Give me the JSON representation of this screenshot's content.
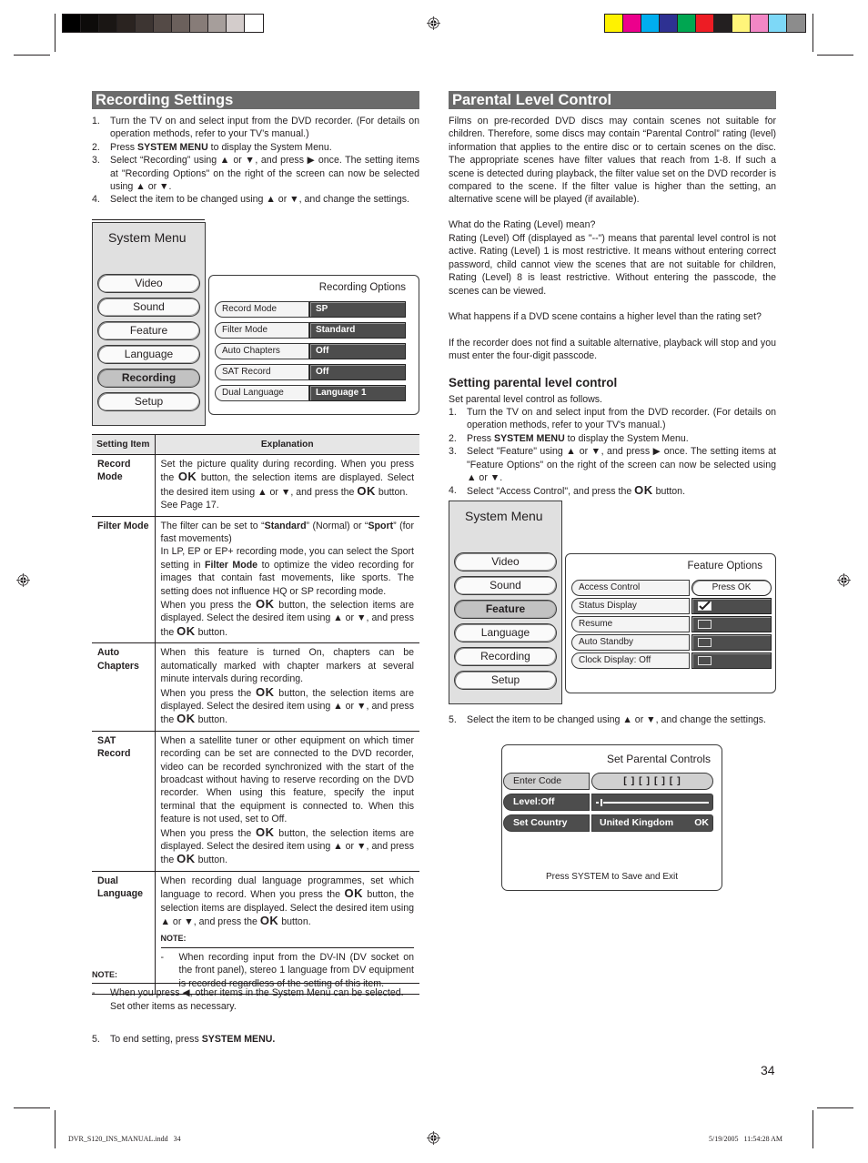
{
  "print_marks": {
    "grayscale_swatches": [
      "#000000",
      "#0d0b0a",
      "#1a1614",
      "#2a2320",
      "#3d3532",
      "#544a46",
      "#6b605c",
      "#877c78",
      "#a69e9b",
      "#d3cccb",
      "#ffffff"
    ],
    "color_swatches": [
      "#fff200",
      "#ec008c",
      "#00aeef",
      "#2e3192",
      "#00a651",
      "#ed1c24",
      "#231f20",
      "#fff57a",
      "#f287c5",
      "#7dd8f7",
      "#8c8c8c"
    ]
  },
  "recording": {
    "title": "Recording Settings",
    "steps": [
      {
        "num": "1.",
        "text": "Turn the TV on and select input from the DVD recorder. (For details on operation methods, refer to your TV’s manual.)"
      },
      {
        "num": "2.",
        "pre": "Press ",
        "bold": "SYSTEM MENU",
        "post": " to display the System Menu."
      },
      {
        "num": "3.",
        "text": "Select “Recording” using ▲ or ▼, and press ▶ once. The setting items at \"Recording Options\" on the right of the screen can now be selected using ▲ or ▼."
      },
      {
        "num": "4.",
        "text": "Select the item to be changed using ▲ or ▼, and change the settings."
      }
    ],
    "system_menu": {
      "title": "System Menu",
      "items": [
        "Video",
        "Sound",
        "Feature",
        "Language",
        "Recording",
        "Setup"
      ],
      "selected": "Recording"
    },
    "options_panel": {
      "title": "Recording Options",
      "rows": [
        {
          "label": "Record Mode",
          "value": "SP"
        },
        {
          "label": "Filter Mode",
          "value": "Standard"
        },
        {
          "label": "Auto Chapters",
          "value": "Off"
        },
        {
          "label": "SAT Record",
          "value": "Off"
        },
        {
          "label": "Dual Language",
          "value": "Language 1"
        }
      ]
    },
    "table": {
      "headers": [
        "Setting Item",
        "Explanation"
      ],
      "rows": [
        {
          "item": "Record Mode",
          "html": "Set the picture quality during recording. When you press the <span class=\"ok\">OK</span> button, the selection items are displayed. Select the desired item using ▲ or ▼, and press the <span class=\"ok\">OK</span> button.<br>See Page 17."
        },
        {
          "item": "Filter Mode",
          "html": "The filter can be set to “<b>Standard</b>” (Normal) or “<b>Sport</b>” (for fast movements)<br>In LP, EP or EP+ recording mode, you can select the Sport setting in <b>Filter Mode</b> to optimize the video recording for images that contain fast movements, like sports. The setting does not influence HQ or SP recording mode.<br>When you press the <span class=\"ok\">OK</span> button, the selection items are displayed. Select the desired item using ▲ or ▼, and press the <span class=\"ok\">OK</span> button."
        },
        {
          "item": "Auto Chapters",
          "html": "When this feature is turned On, chapters can be automatically marked with chapter markers at several minute intervals during recording.<br>When you press the <span class=\"ok\">OK</span> button, the selection items are displayed. Select the desired item using ▲ or ▼, and press the <span class=\"ok\">OK</span> button."
        },
        {
          "item": "SAT Record",
          "html": "When a satellite tuner or other equipment on which timer recording can be set are connected to the DVD recorder, video can be recorded synchronized with the start of the broadcast without having to reserve recording on the DVD recorder. When using this feature, specify the input terminal that the equipment is connected to. When this feature is not used, set to Off.<br>When you press the <span class=\"ok\">OK</span> button, the selection items are displayed. Select the desired item using ▲ or ▼, and press the <span class=\"ok\">OK</span> button."
        },
        {
          "item": "Dual Language",
          "html": "When recording dual language programmes, set which language to record. When you press the <span class=\"ok\">OK</span> button, the selection items are displayed. Select the desired item using ▲ or ▼, and press the <span class=\"ok\">OK</span> button.",
          "note_label": "NOTE:",
          "note": "When recording input from the DV-IN (DV socket on the front panel), stereo 1 language from DV equipment is recorded regardless of the setting of this item."
        }
      ]
    },
    "note": {
      "label": "NOTE:",
      "text": "When you press ◀, other items in the System Menu can be selected.",
      "text2": "Set other items as necessary."
    },
    "step5": {
      "num": "5.",
      "pre": "To end setting, press ",
      "bold": "SYSTEM MENU."
    }
  },
  "parental": {
    "title": "Parental Level Control",
    "intro": "Films on pre-recorded DVD discs may contain scenes not suitable for children. Therefore, some discs may contain “Parental Control” rating (level) information that applies to the entire disc or to certain scenes on the disc. The appropriate scenes have filter values that reach from 1-8. If such a scene is detected during playback, the filter value set on the DVD recorder is compared to the scene. If the filter value is higher than the setting, an alternative scene will be played (if available).",
    "q1": "What do the Rating (Level) mean?",
    "a1": "Rating (Level) Off (displayed as \"--\") means that parental level control is not active. Rating (Level) 1 is most restrictive. It means without entering correct password, child cannot view the scenes that are not suitable for children, Rating (Level) 8 is least restrictive. Without entering the passcode, the scenes can be viewed.",
    "q2": "What happens if a DVD scene contains a higher level than the rating set?",
    "a2": "If the recorder does not find a suitable alternative, playback will stop and you must enter the four-digit passcode.",
    "subheading": "Setting parental level control",
    "sub_intro": "Set parental level control as follows.",
    "steps": [
      {
        "num": "1.",
        "text": "Turn the TV on and select input from the DVD recorder. (For details on operation methods, refer to your TV's manual.)"
      },
      {
        "num": "2.",
        "pre": "Press ",
        "bold": "SYSTEM MENU",
        "post": " to display the System Menu."
      },
      {
        "num": "3.",
        "text": "Select \"Feature\" using ▲ or ▼, and press ▶ once. The setting items at \"Feature Options\" on the right of the screen can now be selected using ▲ or ▼."
      },
      {
        "num": "4.",
        "pre": "Select \"Access Control\", and press the ",
        "ok": "OK",
        "post": " button."
      }
    ],
    "system_menu": {
      "title": "System Menu",
      "items": [
        "Video",
        "Sound",
        "Feature",
        "Language",
        "Recording",
        "Setup"
      ],
      "selected": "Feature"
    },
    "feature_panel": {
      "title": "Feature Options",
      "rows": [
        {
          "label": "Access Control",
          "value": "Press OK",
          "type": "button"
        },
        {
          "label": "Status Display",
          "checked": true,
          "type": "checkbox"
        },
        {
          "label": "Resume",
          "checked": false,
          "type": "checkbox"
        },
        {
          "label": "Auto Standby",
          "checked": false,
          "type": "checkbox"
        },
        {
          "label": "Clock Display: Off",
          "checked": false,
          "type": "checkbox"
        }
      ]
    },
    "step5": {
      "num": "5.",
      "text": "Select the item to be changed using ▲ or ▼, and change the settings."
    },
    "controls_panel": {
      "title": "Set Parental Controls",
      "enter_code_label": "Enter Code",
      "enter_code_value": "[ ] [ ] [ ] [ ]",
      "level_label": "Level:Off",
      "level_fraction": 0.0,
      "country_label": "Set Country",
      "country_value": "United Kingdom",
      "country_ok": "OK",
      "footer": "Press SYSTEM to Save and Exit"
    }
  },
  "page_number": "34",
  "slug_left": "DVR_S120_INS_MANUAL.indd   34",
  "slug_right": "5/19/2005   11:54:28 AM"
}
